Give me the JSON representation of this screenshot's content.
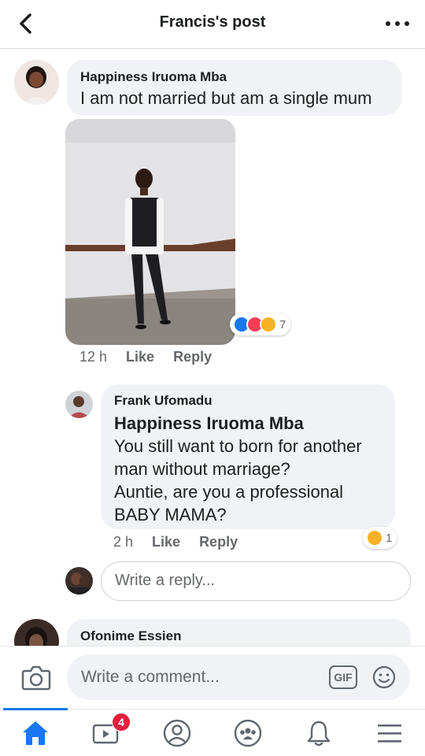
{
  "header": {
    "title": "Francis's post"
  },
  "comment1": {
    "author": "Happiness Iruoma Mba",
    "text": "I am not married but am a single mum",
    "time": "12 h",
    "like": "Like",
    "reply": "Reply",
    "reaction_count": "7",
    "reactions": [
      "like-icon",
      "love-icon",
      "haha-icon"
    ]
  },
  "reply1": {
    "author": "Frank Ufomadu",
    "mention": "Happiness Iruoma Mba",
    "lines": [
      "You still want to born for another",
      "man without marriage?",
      "Auntie, are you a professional",
      "BABY MAMA?"
    ],
    "time": "2 h",
    "like": "Like",
    "reply": "Reply",
    "reaction_count": "1"
  },
  "reply_input": {
    "placeholder": "Write a reply..."
  },
  "comment2": {
    "author": "Ofonime Essien"
  },
  "composer": {
    "placeholder": "Write a comment...",
    "gif": "GIF"
  },
  "tabbar": {
    "video_badge": "4"
  },
  "colors": {
    "accent": "#1877f2",
    "bubble": "#f0f2f5",
    "badge": "#e41e3f"
  }
}
